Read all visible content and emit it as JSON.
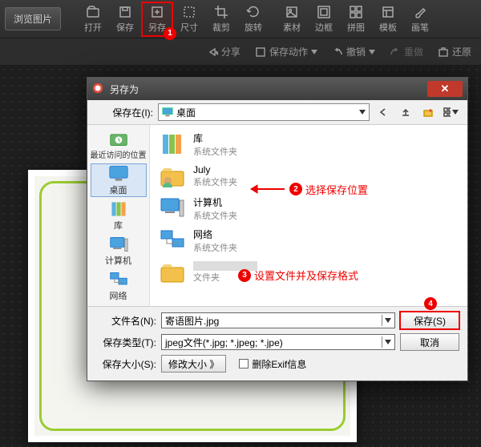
{
  "topbar": {
    "browse": "浏览图片",
    "tools": [
      {
        "label": "打开",
        "name": "open"
      },
      {
        "label": "保存",
        "name": "save"
      },
      {
        "label": "另存",
        "name": "save-as",
        "highlight": true,
        "badge": "1"
      },
      {
        "label": "尺寸",
        "name": "size"
      },
      {
        "label": "裁剪",
        "name": "crop"
      },
      {
        "label": "旋转",
        "name": "rotate"
      },
      {
        "label": "素材",
        "name": "assets"
      },
      {
        "label": "边框",
        "name": "border"
      },
      {
        "label": "拼图",
        "name": "collage"
      },
      {
        "label": "模板",
        "name": "template"
      },
      {
        "label": "画笔",
        "name": "brush"
      }
    ]
  },
  "subbar": {
    "share": "分享",
    "save_action": "保存动作",
    "undo": "撤销",
    "redo": "重做",
    "restore": "还原"
  },
  "dialog": {
    "title": "另存为",
    "save_in_label": "保存在(I):",
    "location": "桌面",
    "places": [
      {
        "label": "最近访问的位置",
        "name": "recent"
      },
      {
        "label": "桌面",
        "name": "desktop",
        "selected": true
      },
      {
        "label": "库",
        "name": "libraries"
      },
      {
        "label": "计算机",
        "name": "computer"
      },
      {
        "label": "网络",
        "name": "network"
      }
    ],
    "files": [
      {
        "name": "库",
        "sub": "系统文件夹",
        "type": "libs"
      },
      {
        "name": "July",
        "sub": "系统文件夹",
        "type": "user"
      },
      {
        "name": "计算机",
        "sub": "系统文件夹",
        "type": "pc"
      },
      {
        "name": "网络",
        "sub": "系统文件夹",
        "type": "net"
      },
      {
        "name": "",
        "sub": "文件夹",
        "type": "folder"
      }
    ],
    "filename_label": "文件名(N):",
    "filename_value": "寄语图片.jpg",
    "filetype_label": "保存类型(T):",
    "filetype_value": "jpeg文件(*.jpg; *.jpeg; *.jpe)",
    "filesize_label": "保存大小(S):",
    "resize_btn": "修改大小 》",
    "exif_label": "删除Exif信息",
    "save_btn": "保存(S)",
    "cancel_btn": "取消"
  },
  "annotations": {
    "step2": "选择保存位置",
    "step3": "设置文件并及保存格式",
    "badge2": "2",
    "badge3": "3",
    "badge4": "4"
  }
}
